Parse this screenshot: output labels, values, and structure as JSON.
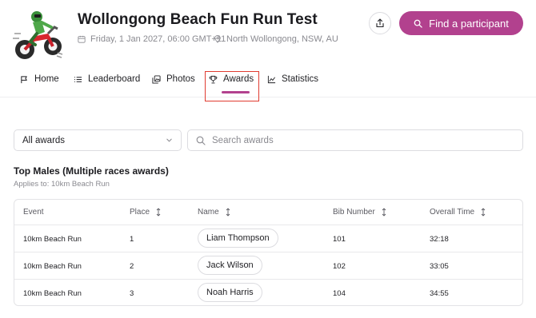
{
  "event": {
    "title": "Wollongong Beach Fun Run Test",
    "date": "Friday, 1 Jan 2027, 06:00 GMT+11",
    "location": "North Wollongong, NSW, AU",
    "logo_icon": "motocross-rider-logo"
  },
  "actions": {
    "share_icon": "share-icon",
    "find_participant_label": "Find a participant"
  },
  "tabs": [
    {
      "label": "Home",
      "icon": "flag-icon"
    },
    {
      "label": "Leaderboard",
      "icon": "list-icon"
    },
    {
      "label": "Photos",
      "icon": "photos-icon"
    },
    {
      "label": "Awards",
      "icon": "trophy-icon",
      "active": true
    },
    {
      "label": "Statistics",
      "icon": "chart-icon"
    }
  ],
  "filters": {
    "awards_select_value": "All awards",
    "search_placeholder": "Search awards"
  },
  "award_section": {
    "title": "Top Males (Multiple races awards)",
    "applies_to": "Applies to: 10km Beach Run",
    "columns": [
      "Event",
      "Place",
      "Name",
      "Bib Number",
      "Overall Time"
    ],
    "rows": [
      {
        "event": "10km Beach Run",
        "place": "1",
        "name": "Liam Thompson",
        "bib": "101",
        "time": "32:18"
      },
      {
        "event": "10km Beach Run",
        "place": "2",
        "name": "Jack Wilson",
        "bib": "102",
        "time": "33:05"
      },
      {
        "event": "10km Beach Run",
        "place": "3",
        "name": "Noah Harris",
        "bib": "104",
        "time": "34:55"
      }
    ]
  },
  "colors": {
    "accent": "#b2418e",
    "highlight_box": "#e03c31",
    "muted_text": "#8a8a90"
  }
}
